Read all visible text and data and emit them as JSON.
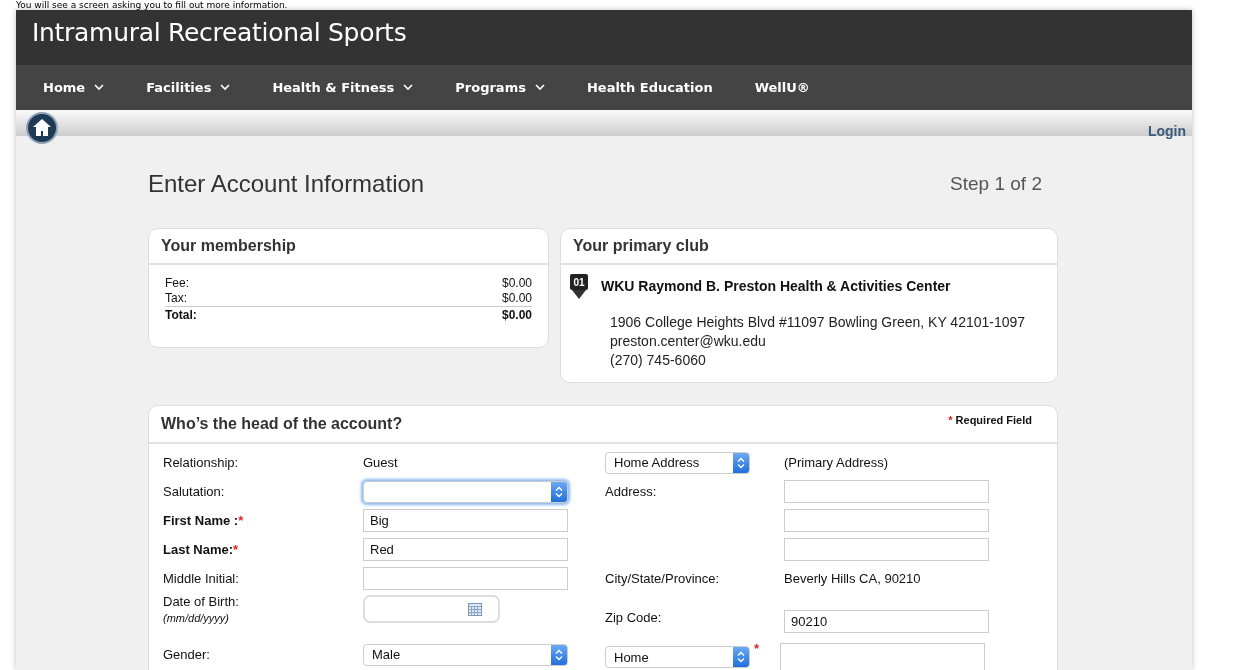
{
  "caption": "You will see a screen asking you to fill out more information.",
  "header": {
    "title": "Intramural Recreational Sports"
  },
  "nav": [
    {
      "label": "Home",
      "has_menu": true
    },
    {
      "label": "Facilities",
      "has_menu": true
    },
    {
      "label": "Health & Fitness",
      "has_menu": true
    },
    {
      "label": "Programs",
      "has_menu": true
    },
    {
      "label": "Health Education",
      "has_menu": false
    },
    {
      "label": "WellU®",
      "has_menu": false
    }
  ],
  "login": "Login",
  "page": {
    "title": "Enter Account Information",
    "step": "Step 1 of 2"
  },
  "membership": {
    "title": "Your membership",
    "lines": [
      {
        "label": "Fee:",
        "value": "$0.00",
        "kind": "normal"
      },
      {
        "label": "Tax:",
        "value": "$0.00",
        "kind": "normal"
      },
      {
        "label": "Total:",
        "value": "$0.00",
        "kind": "total"
      }
    ]
  },
  "club": {
    "title": "Your primary club",
    "badge": "01",
    "name": "WKU Raymond B. Preston Health & Activities Center",
    "address": "1906 College Heights Blvd #11097 Bowling Green, KY 42101-1097",
    "email": "preston.center@wku.edu",
    "phone": "(270) 745-6060"
  },
  "head": {
    "title": "Who’s the head of the account?",
    "required_mark": "*",
    "required_note": "Required Field",
    "left_rows": [
      {
        "label": "Relationship:",
        "kind": "static",
        "value": "Guest",
        "required": false
      },
      {
        "label": "Salutation:",
        "kind": "select",
        "value": "",
        "required": false,
        "focused": true
      },
      {
        "label": "First Name :",
        "kind": "text",
        "value": "Big",
        "required": true
      },
      {
        "label": "Last Name:",
        "kind": "text",
        "value": "Red",
        "required": true
      },
      {
        "label": "Middle Initial:",
        "kind": "text",
        "value": "",
        "required": false
      },
      {
        "label": "Date of Birth:",
        "sublabel": "(mm/dd/yyyy)",
        "kind": "date",
        "value": "",
        "required": false
      },
      {
        "label": "Gender:",
        "kind": "select",
        "value": "Male",
        "required": false,
        "focused": false
      }
    ],
    "right_rows": [
      {
        "kind": "select-note",
        "value": "Home Address",
        "note": "(Primary Address)",
        "required": false
      },
      {
        "label": "Address:",
        "kind": "text",
        "value": "",
        "required": false
      },
      {
        "kind": "text",
        "value": "",
        "required": false
      },
      {
        "kind": "text",
        "value": "",
        "required": false
      },
      {
        "label": "City/State/Province:",
        "kind": "static",
        "value": "Beverly Hills CA, 90210",
        "required": false
      },
      {
        "label": "Zip Code:",
        "kind": "text",
        "value": "90210",
        "required": false
      },
      {
        "kind": "select-input",
        "value": "Home",
        "input": "",
        "required": true
      }
    ]
  }
}
